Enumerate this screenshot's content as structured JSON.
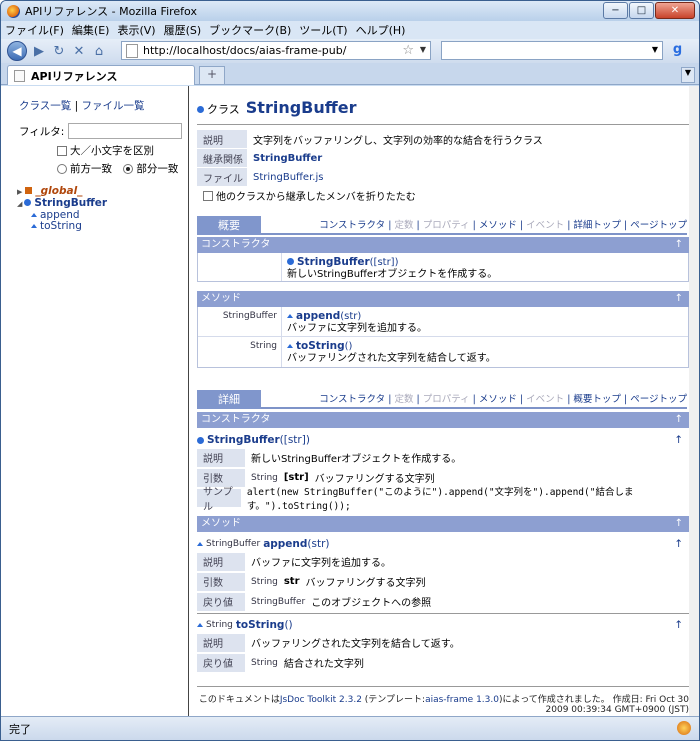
{
  "window": {
    "title": "APIリファレンス - Mozilla Firefox",
    "min": "−",
    "max": "□",
    "close": "✕"
  },
  "menu": [
    "ファイル(F)",
    "編集(E)",
    "表示(V)",
    "履歴(S)",
    "ブックマーク(B)",
    "ツール(T)",
    "ヘルプ(H)"
  ],
  "nav": {
    "url": "http://localhost/docs/aias-frame-pub/",
    "search_value": "",
    "google": "g"
  },
  "tab": {
    "label": "APIリファレンス",
    "new": "+"
  },
  "sidebar": {
    "class_list": "クラス一覧",
    "sep": "|",
    "file_list": "ファイル一覧",
    "filter_label": "フィルタ:",
    "filter_value": "",
    "case_label": "大／小文字を区別",
    "prefix_label": "前方一致",
    "partial_label": "部分一致",
    "tree": {
      "global": "_global_",
      "class": "StringBuffer",
      "m1": "append",
      "m2": "toString"
    }
  },
  "main": {
    "class_prefix": "クラス",
    "class_name": "StringBuffer",
    "info": {
      "desc_label": "説明",
      "desc": "文字列をバッファリングし、文字列の効率的な結合を行うクラス",
      "inherit_label": "継承関係",
      "inherit": "StringBuffer",
      "file_label": "ファイル",
      "file": "StringBuffer.js",
      "collapse": "他のクラスから継承したメンバを折りたたむ"
    },
    "summary": {
      "tab": "概要",
      "links": {
        "ctor": "コンストラクタ",
        "s1": " | ",
        "def": "定数",
        "s2": " | ",
        "prop": "プロパティ",
        "s3": " | ",
        "meth": "メソッド",
        "s4": " | ",
        "evt": "イベント",
        "s5": " | ",
        "top": "詳細トップ",
        "s6": " | ",
        "page": "ページトップ"
      },
      "ctor_header": "コンストラクタ",
      "ctor_name": "StringBuffer",
      "ctor_params": "([str])",
      "ctor_desc": "新しいStringBufferオブジェクトを作成する。",
      "method_header": "メソッド",
      "m1_type": "StringBuffer",
      "m1_name": "append",
      "m1_params": "(str)",
      "m1_desc": "バッファに文字列を追加する。",
      "m2_type": "String",
      "m2_name": "toString",
      "m2_params": "()",
      "m2_desc": "バッファリングされた文字列を結合して返す。"
    },
    "detail": {
      "tab": "詳細",
      "links": {
        "ctor": "コンストラクタ",
        "s1": " | ",
        "def": "定数",
        "s2": " | ",
        "prop": "プロパティ",
        "s3": " | ",
        "meth": "メソッド",
        "s4": " | ",
        "evt": "イベント",
        "s5": " | ",
        "top": "概要トップ",
        "s6": " | ",
        "page": "ページトップ"
      },
      "ctor_header": "コンストラクタ",
      "ctor_name": "StringBuffer",
      "ctor_params": "([str])",
      "ctor_desc_label": "説明",
      "ctor_desc": "新しいStringBufferオブジェクトを作成する。",
      "ctor_arg_label": "引数",
      "ctor_arg_type": "String",
      "ctor_arg_name": "[str]",
      "ctor_arg_desc": "バッファリングする文字列",
      "ctor_sample_label": "サンプル",
      "ctor_sample": "alert(new StringBuffer(\"このように\").append(\"文字列を\").append(\"結合します。\").toString());",
      "method_header": "メソッド",
      "m1_type": "StringBuffer",
      "m1_name": "append",
      "m1_params": "(str)",
      "m1_desc_label": "説明",
      "m1_desc": "バッファに文字列を追加する。",
      "m1_arg_label": "引数",
      "m1_arg_type": "String",
      "m1_arg_name": "str",
      "m1_arg_desc": "バッファリングする文字列",
      "m1_ret_label": "戻り値",
      "m1_ret_type": "StringBuffer",
      "m1_ret_desc": "このオブジェクトへの参照",
      "m2_type": "String",
      "m2_name": "toString",
      "m2_params": "()",
      "m2_desc_label": "説明",
      "m2_desc": "バッファリングされた文字列を結合して返す。",
      "m2_ret_label": "戻り値",
      "m2_ret_type": "String",
      "m2_ret_desc": "結合された文字列"
    },
    "up_arrow": "↑",
    "footer": {
      "pre": "このドキュメントは",
      "tool": "JsDoc Toolkit 2.3.2",
      "mid": " (テンプレート:",
      "tpl": "aias-frame 1.3.0",
      "post": ")によって作成されました。 作成日: Fri Oct 30 2009 00:39:34 GMT+0900 (JST)"
    }
  },
  "status": "完了"
}
